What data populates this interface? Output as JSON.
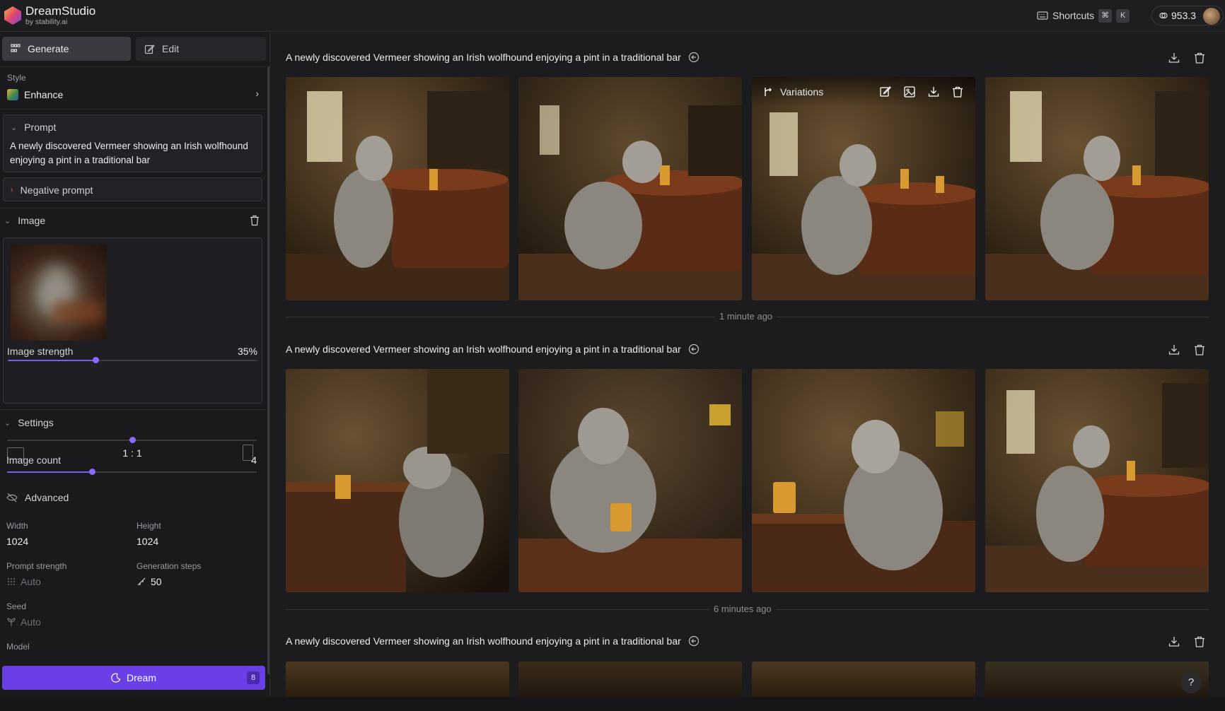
{
  "app": {
    "name": "DreamStudio",
    "subtitle": "by stability.ai",
    "shortcuts_label": "Shortcuts",
    "shortcut_keys": [
      "⌘",
      "K"
    ],
    "credits": "953.3"
  },
  "sidebar": {
    "tabs": [
      {
        "label": "Generate",
        "active": true
      },
      {
        "label": "Edit",
        "active": false
      }
    ],
    "style": {
      "label": "Style",
      "value": "Enhance"
    },
    "prompt": {
      "label": "Prompt",
      "text": "A newly discovered Vermeer showing an Irish wolfhound enjoying a pint in a traditional bar"
    },
    "negative_prompt": {
      "label": "Negative prompt"
    },
    "image": {
      "label": "Image",
      "strength_label": "Image strength",
      "strength_value": "35%",
      "strength_fraction": 0.35
    },
    "settings": {
      "label": "Settings",
      "aspect_ratio": "1 : 1",
      "aspect_fraction": 0.5,
      "image_count_label": "Image count",
      "image_count": "4",
      "image_count_fraction": 0.34
    },
    "advanced": {
      "label": "Advanced",
      "width_label": "Width",
      "width": "1024",
      "height_label": "Height",
      "height": "1024",
      "prompt_strength_label": "Prompt strength",
      "prompt_strength": "Auto",
      "generation_steps_label": "Generation steps",
      "generation_steps": "50",
      "seed_label": "Seed",
      "seed": "Auto",
      "model_label": "Model"
    },
    "dream_button": {
      "label": "Dream",
      "cost": "8"
    }
  },
  "main": {
    "groups": [
      {
        "prompt": "A newly discovered Vermeer showing an Irish wolfhound enjoying a pint in a traditional bar",
        "time": "1 minute ago"
      },
      {
        "prompt": "A newly discovered Vermeer showing an Irish wolfhound enjoying a pint in a traditional bar",
        "time": "6 minutes ago"
      },
      {
        "prompt": "A newly discovered Vermeer showing an Irish wolfhound enjoying a pint in a traditional bar",
        "time": ""
      }
    ],
    "hover_overlay": {
      "variations_label": "Variations"
    },
    "help_label": "?"
  },
  "colors": {
    "accent": "#6a3fe6",
    "slider": "#7b5cf0",
    "background": "#1c1c1f",
    "sidebar": "#1a1a1d"
  },
  "icons": [
    "logo-icon",
    "keyboard-icon",
    "credits-icon",
    "grid-icon",
    "edit-icon",
    "chevron-right-icon",
    "chevron-down-icon",
    "trash-icon",
    "landscape-icon",
    "portrait-icon",
    "hide-icon",
    "grid-dots-icon",
    "steps-icon",
    "seed-icon",
    "moon-icon",
    "reuse-icon",
    "download-icon",
    "variations-icon",
    "image-icon",
    "help-icon"
  ]
}
